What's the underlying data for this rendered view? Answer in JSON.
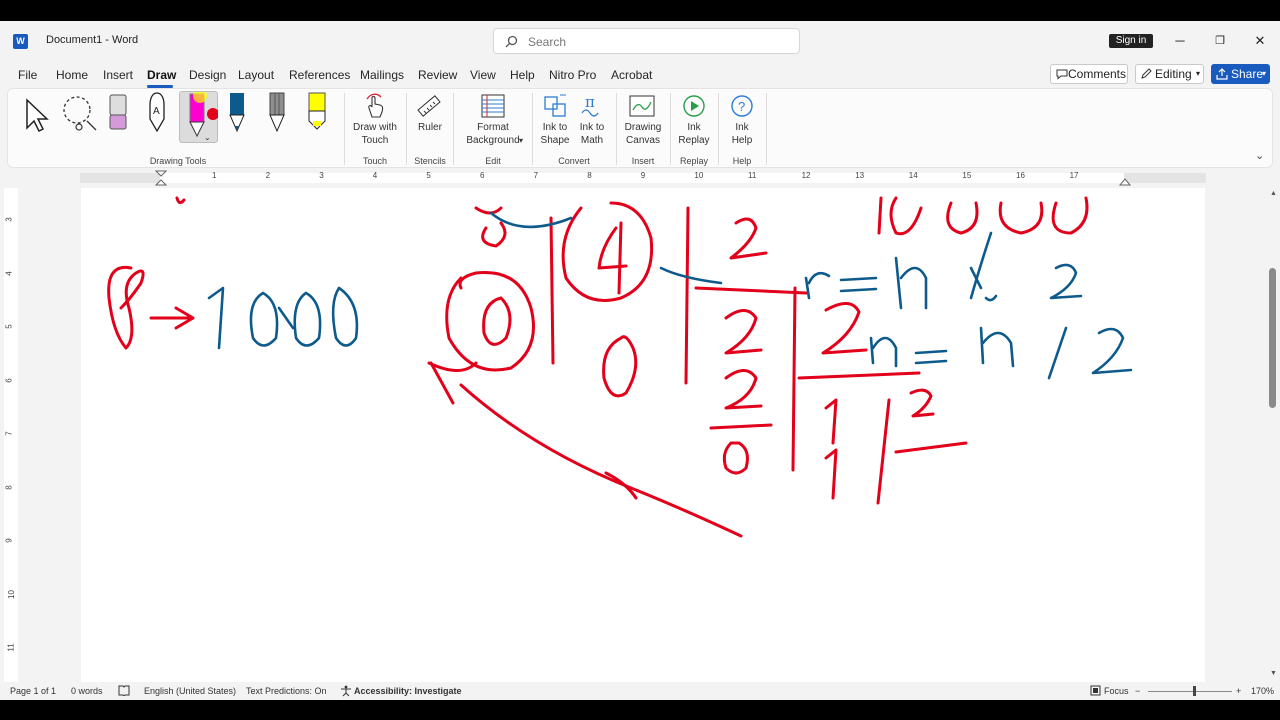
{
  "titlebar": {
    "app_icon_text": "W",
    "document_title": "Document1  -  Word",
    "search_placeholder": "Search",
    "sign_in": "Sign in",
    "minimize_glyph": "─",
    "restore_glyph": "❐",
    "close_glyph": "✕"
  },
  "menu": {
    "items": [
      "File",
      "Home",
      "Insert",
      "Draw",
      "Design",
      "Layout",
      "References",
      "Mailings",
      "Review",
      "View",
      "Help",
      "Nitro Pro",
      "Acrobat"
    ],
    "active": "Draw",
    "comments": "Comments",
    "editing": "Editing",
    "share": "Share"
  },
  "ribbon": {
    "groups": {
      "drawing_tools": "Drawing Tools",
      "touch": "Touch",
      "stencils": "Stencils",
      "edit": "Edit",
      "convert": "Convert",
      "insert": "Insert",
      "replay": "Replay",
      "help": "Help"
    },
    "buttons": {
      "draw_with_touch_1": "Draw with",
      "draw_with_touch_2": "Touch",
      "ruler": "Ruler",
      "format_bg_1": "Format",
      "format_bg_2": "Background",
      "ink_to_shape_1": "Ink to",
      "ink_to_shape_2": "Shape",
      "ink_to_math_1": "Ink to",
      "ink_to_math_2": "Math",
      "drawing_canvas_1": "Drawing",
      "drawing_canvas_2": "Canvas",
      "ink_replay_1": "Ink",
      "ink_replay_2": "Replay",
      "ink_help_1": "Ink",
      "ink_help_2": "Help"
    },
    "colors": {
      "pen_red": "#e3001b",
      "pen_blue": "#0d5a8c",
      "highlighter": "#ffff00",
      "pink": "#ff00d0"
    }
  },
  "ruler": {
    "h_numbers": [
      "1",
      "2",
      "3",
      "4",
      "5",
      "6",
      "7",
      "8",
      "9",
      "10",
      "11",
      "12",
      "13",
      "14",
      "15",
      "16",
      "17"
    ],
    "v_numbers": [
      "3",
      "4",
      "5",
      "6",
      "7",
      "8",
      "9",
      "10",
      "11"
    ]
  },
  "canvas": {
    "ink_red": "#e3001b",
    "ink_blue": "#0d5a8c"
  },
  "status": {
    "page": "Page 1 of 1",
    "words": "0 words",
    "language": "English (United States)",
    "text_predictions": "Text Predictions: On",
    "accessibility": "Accessibility: Investigate",
    "focus": "Focus",
    "zoom": "170%"
  }
}
